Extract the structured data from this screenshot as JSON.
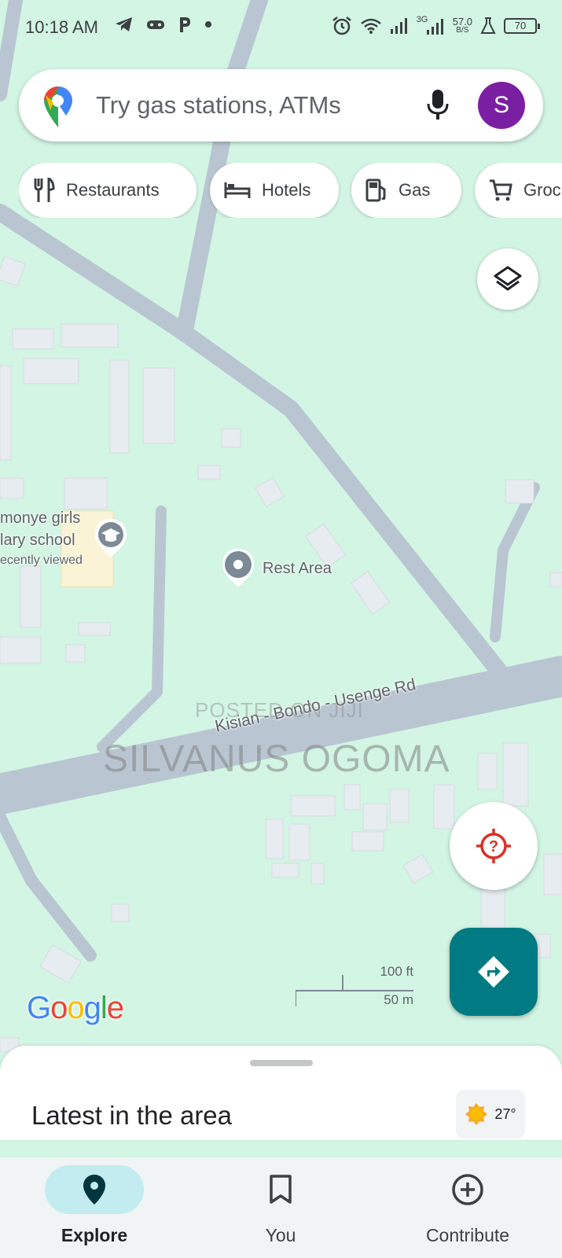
{
  "status_bar": {
    "time": "10:18 AM",
    "speed_value": "57.0",
    "speed_unit": "B/S",
    "network": "3G",
    "battery": "70",
    "icons": [
      "telegram-icon",
      "gamepad-icon",
      "p-icon",
      "dot-icon",
      "alarm-icon",
      "wifi-icon",
      "signal-icon",
      "signal-3g-icon",
      "flask-icon",
      "battery-icon"
    ]
  },
  "search": {
    "placeholder": "Try gas stations, ATMs",
    "avatar_letter": "S",
    "avatar_color": "#7b1fa2"
  },
  "chips": [
    {
      "label": "Restaurants",
      "icon": "fork-knife-icon"
    },
    {
      "label": "Hotels",
      "icon": "bed-icon"
    },
    {
      "label": "Gas",
      "icon": "gas-pump-icon"
    },
    {
      "label": "Groc",
      "icon": "cart-icon"
    }
  ],
  "map": {
    "school_line1": "monye girls",
    "school_line2": "lary school",
    "school_sub": "ecently viewed",
    "rest_area": "Rest Area",
    "road_name": "Kisian - Bondo - Usenge Rd",
    "watermark_top": "POSTED ON JIJI",
    "watermark_main": "SILVANUS OGOMA",
    "scale_ft": "100 ft",
    "scale_m": "50 m",
    "logo": "Google"
  },
  "sheet": {
    "title": "Latest in the area",
    "temperature": "27°"
  },
  "nav": [
    {
      "label": "Explore",
      "icon": "location-pin-icon",
      "active": true
    },
    {
      "label": "You",
      "icon": "bookmark-icon",
      "active": false
    },
    {
      "label": "Contribute",
      "icon": "add-circle-icon",
      "active": false
    }
  ],
  "colors": {
    "map_bg": "#d3f5e4",
    "road": "#b8c7d3",
    "directions_fab": "#007b83",
    "explore_active": "#c2ecf0"
  }
}
